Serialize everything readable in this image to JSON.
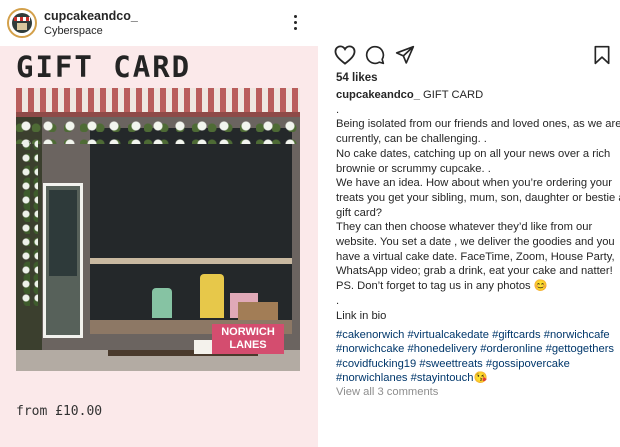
{
  "header": {
    "username": "cupcakeandco_",
    "location": "Cyberspace",
    "more_icon": "more-vertical-icon"
  },
  "post_image": {
    "title": "GIFT CARD",
    "price": "from £10.00",
    "photo_sign": "NORWICH\nLANES",
    "colors": {
      "background": "#fbe9ea",
      "awning_red": "#b95e5c",
      "sign": "#d44d6f"
    }
  },
  "actions": {
    "like_icon": "heart-icon",
    "comment_icon": "comment-icon",
    "share_icon": "send-icon",
    "save_icon": "bookmark-icon"
  },
  "likes": "54 likes",
  "caption": {
    "username": "cupcakeandco_",
    "first": " GIFT CARD",
    "lines": [
      ".",
      "Being isolated from our friends and loved ones, as we are",
      "currently, can be challenging. .",
      "No cake dates, catching up on all your news over a rich",
      "brownie or scrummy cupcake. .",
      "We have an idea.  How about when you’re ordering your",
      "treats you get your sibling, mum, son, daughter or bestie a",
      "gift card?",
      "They can then choose whatever they’d like from our",
      "website.  You set a date , we deliver the goodies and you",
      "have a virtual cake date. FaceTime, Zoom, House Party,",
      "WhatsApp video; grab a drink, eat your cake and natter!",
      "PS. Don’t forget to tag us in any photos 😊",
      ".",
      "Link in bio",
      "."
    ]
  },
  "hashtags": [
    [
      "#cakenorwich",
      "#virtualcakedate",
      "#giftcards",
      "#norwichcafe"
    ],
    [
      "#norwichcake",
      "#honedelivery",
      "#orderonline",
      "#gettogethers"
    ],
    [
      "#covidfucking19",
      "#sweettreats",
      "#gossipovercake"
    ],
    [
      "#norwichlanes",
      "#stayintouch😘"
    ]
  ],
  "comments_link": "View all 3 comments"
}
